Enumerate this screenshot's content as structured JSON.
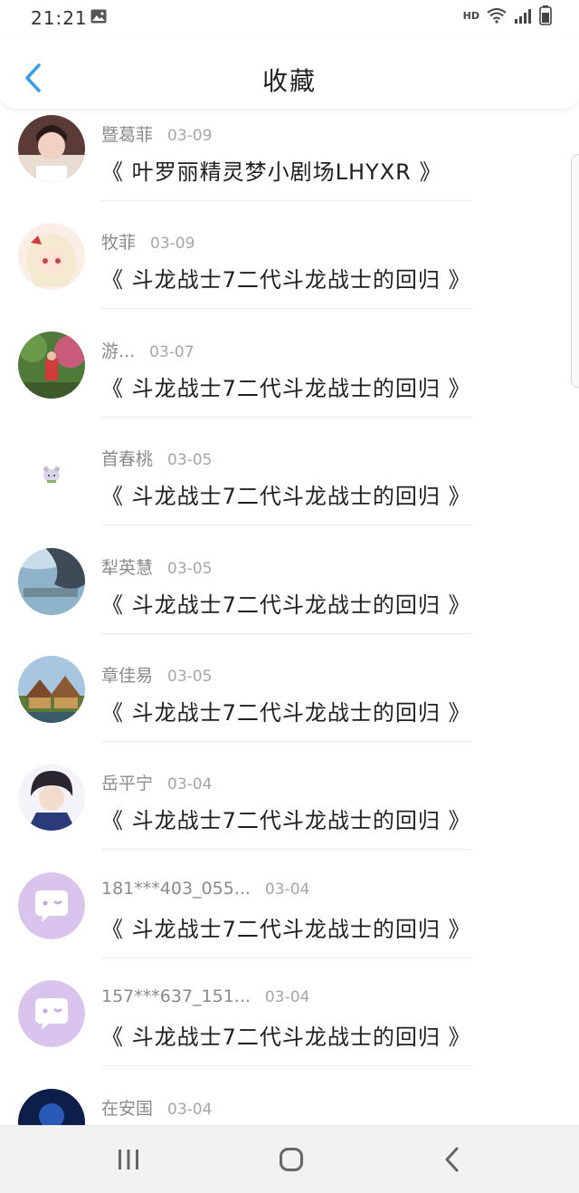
{
  "status_bar": {
    "time": "21:21",
    "hd": "HD",
    "network": "4G"
  },
  "header": {
    "title": "收藏"
  },
  "list": [
    {
      "name": "暨葛菲",
      "date": "03-09",
      "work": "《 叶罗丽精灵梦小剧场LHYXR 》",
      "avatar": "photo-girl"
    },
    {
      "name": "牧菲",
      "date": "03-09",
      "work": "《 斗龙战士7二代斗龙战士的回归 》",
      "avatar": "anime-girl"
    },
    {
      "name": "游...",
      "date": "03-07",
      "work": "《 斗龙战士7二代斗龙战士的回归 》",
      "avatar": "photo-park"
    },
    {
      "name": "首春桃",
      "date": "03-05",
      "work": "《 斗龙战士7二代斗龙战士的回归 》",
      "avatar": "tiny-mouse"
    },
    {
      "name": "犁英慧",
      "date": "03-05",
      "work": "《 斗龙战士7二代斗龙战士的回归 》",
      "avatar": "blue-photo"
    },
    {
      "name": "章佳易",
      "date": "03-05",
      "work": "《 斗龙战士7二代斗龙战士的回归 》",
      "avatar": "cottage"
    },
    {
      "name": "岳平宁",
      "date": "03-04",
      "work": "《 斗龙战士7二代斗龙战士的回归 》",
      "avatar": "anime-boy"
    },
    {
      "name": "181***403_055...",
      "date": "03-04",
      "work": "《 斗龙战士7二代斗龙战士的回归 》",
      "avatar": "default-chat"
    },
    {
      "name": "157***637_151...",
      "date": "03-04",
      "work": "《 斗龙战士7二代斗龙战士的回归 》",
      "avatar": "default-chat"
    },
    {
      "name": "在安国",
      "date": "03-04",
      "work": "",
      "avatar": "dark-blue"
    }
  ],
  "colors": {
    "accent": "#3a9be8",
    "default_avatar": "#d9c4ee"
  }
}
